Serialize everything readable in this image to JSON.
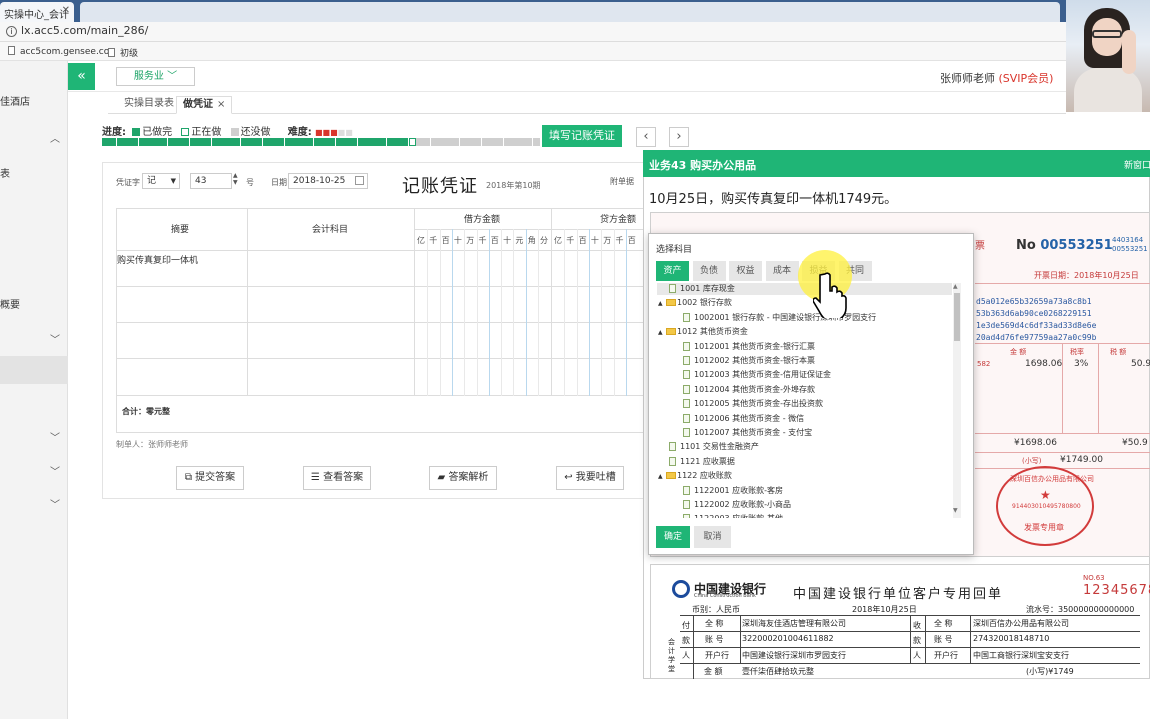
{
  "browser": {
    "tab_title": "实操中心_会计",
    "url": "lx.acc5.com/main_286/",
    "bookmarks": [
      "acc5com.gensee.co",
      "初级"
    ]
  },
  "sidebar": {
    "items": [
      {
        "label": "佳酒店"
      },
      {
        "label": "表"
      },
      {
        "label": "概要"
      }
    ]
  },
  "topbar": {
    "collapse_icon": "«",
    "service_dropdown": "服务业",
    "teacher_name": "张师师老师",
    "vip_badge": "(SVIP会员)"
  },
  "subtabs": [
    "实操目录表",
    "做凭证"
  ],
  "progress": {
    "label": "进度:",
    "done": "已做完",
    "doing": "正在做",
    "todo": "还没做",
    "difficulty_label": "难度:",
    "difficulty_stars": 3,
    "difficulty_max": 5,
    "done_count": 42,
    "total_count": 60,
    "colors": {
      "done": "#1fa56b",
      "todo": "#cfcfcf",
      "accent": "#1fb576"
    }
  },
  "fill_button": "填写记账凭证",
  "voucher": {
    "type_label": "凭证字",
    "type_value": "记",
    "number_value": "43",
    "number_suffix": "号",
    "date_label": "日期",
    "date_value": "2018-10-25",
    "title": "记账凭证",
    "period": "2018年第10期",
    "attach_label": "附单据",
    "col_summary": "摘要",
    "col_account": "会计科目",
    "col_debit": "借方金额",
    "col_credit": "贷方金额",
    "digits": [
      "亿",
      "千",
      "百",
      "十",
      "万",
      "千",
      "百",
      "十",
      "元",
      "角",
      "分"
    ],
    "rows": [
      {
        "summary": "购买传真复印一体机"
      }
    ],
    "total": "合计：零元整",
    "maker": "制单人：张师师老师"
  },
  "actions": [
    "提交答案",
    "查看答案",
    "答案解析",
    "我要吐槽"
  ],
  "task": {
    "title": "业务43 购买办公用品",
    "new_window": "新窗口",
    "description": "10月25日，购买传真复印一体机1749元。"
  },
  "invoice": {
    "ticket": "票",
    "no_label": "No",
    "no_value": "00553251",
    "side_code_1": "4403164",
    "side_code_2": "00553251",
    "date": "开票日期：2018年10月25日",
    "cipher": [
      "d5a012e65b32659a73a8c8b1",
      "53b363d6ab90ce0268229151",
      "1e3de569d4c6df33ad33d8e6e",
      "20ad4d76fe97759aa27a0c99b"
    ],
    "head_amount": "金 额",
    "head_rate": "税率",
    "head_tax": "税 额",
    "amount": "1698.06",
    "rate": "3%",
    "tax": "50.9",
    "amount_total": "¥1698.06",
    "tax_total": "¥50.9",
    "small_label": "(小写)",
    "total_small": "¥1749.00",
    "seal_top": "深圳百信办公用品有限公司",
    "seal_number": "914403010495780800",
    "seal_bottom": "发票专用章",
    "left_number": "582"
  },
  "bank": {
    "name": "中国建设银行",
    "name_en": "China Construction Bank",
    "title": "中国建设银行单位客户专用回单",
    "no_label": "NO.63",
    "serial": "12345678",
    "currency": "币别：人民币",
    "date": "2018年10月25日",
    "flow": "流水号：350000000000000",
    "payer_label": "付款人",
    "payee_label": "收款人",
    "field_name": "全 称",
    "field_account": "账 号",
    "field_bank": "开户行",
    "payer_name": "深圳海友佳酒店管理有限公司",
    "payer_account": "322000201004611882",
    "payer_bank": "中国建设银行深圳市罗园支行",
    "payee_name": "深圳百信办公用品有限公司",
    "payee_account": "274320018148710",
    "payee_bank": "中国工商银行深圳宝安支行",
    "amount_label": "金 额",
    "amount_words": "壹仟柒佰肆拾玖元整",
    "amount_small": "(小写)¥1749",
    "side_label": "会计学堂"
  },
  "modal": {
    "title": "选择科目",
    "tabs": [
      "资产",
      "负债",
      "权益",
      "成本",
      "损益",
      "共同"
    ],
    "tree": [
      {
        "label": "1001 库存现金",
        "kind": "file",
        "level": 0
      },
      {
        "label": "1002 银行存款",
        "kind": "folder",
        "level": 0
      },
      {
        "label": "1002001 银行存款 - 中国建设银行深圳市罗园支行",
        "kind": "file",
        "level": 1
      },
      {
        "label": "1012 其他货币资金",
        "kind": "folder",
        "level": 0
      },
      {
        "label": "1012001 其他货币资金-银行汇票",
        "kind": "file",
        "level": 1
      },
      {
        "label": "1012002 其他货币资金-银行本票",
        "kind": "file",
        "level": 1
      },
      {
        "label": "1012003 其他货币资金-信用证保证金",
        "kind": "file",
        "level": 1
      },
      {
        "label": "1012004 其他货币资金-外埠存款",
        "kind": "file",
        "level": 1
      },
      {
        "label": "1012005 其他货币资金-存出投资款",
        "kind": "file",
        "level": 1
      },
      {
        "label": "1012006 其他货币资金 - 微信",
        "kind": "file",
        "level": 1
      },
      {
        "label": "1012007 其他货币资金 - 支付宝",
        "kind": "file",
        "level": 1
      },
      {
        "label": "1101 交易性金融资产",
        "kind": "file",
        "level": 0
      },
      {
        "label": "1121 应收票据",
        "kind": "file",
        "level": 0
      },
      {
        "label": "1122 应收账款",
        "kind": "folder",
        "level": 0
      },
      {
        "label": "1122001 应收账款-客房",
        "kind": "file",
        "level": 1
      },
      {
        "label": "1122002 应收账款-小商品",
        "kind": "file",
        "level": 1
      },
      {
        "label": "1122003 应收账款-其他",
        "kind": "file",
        "level": 1
      }
    ],
    "ok": "确定",
    "cancel": "取消"
  }
}
